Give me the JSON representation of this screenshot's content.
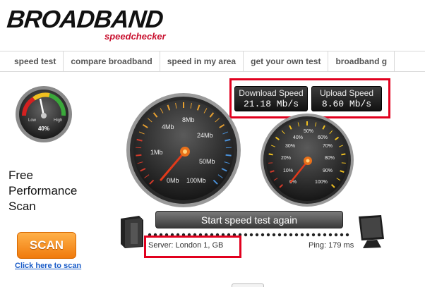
{
  "logo": {
    "word": "BROADBAND",
    "sub": "speedchecker"
  },
  "nav": [
    "speed test",
    "compare broadband",
    "speed in my area",
    "get your own test",
    "broadband g"
  ],
  "mini_gauge": {
    "low": "Low",
    "high": "High",
    "percent": "40%",
    "level": 0.4
  },
  "promo": {
    "line1": "Free",
    "line2": "Performance",
    "line3": "Scan"
  },
  "scan": {
    "button": "SCAN",
    "link": "Click here to scan"
  },
  "download": {
    "label": "Download Speed",
    "value": "21.18  Mb/s"
  },
  "upload": {
    "label": "Upload Speed",
    "value": "8.60  Mb/s"
  },
  "speed_gauge": {
    "ticks": [
      "0Mb",
      "1Mb",
      "4Mb",
      "8Mb",
      "24Mb",
      "50Mb",
      "100Mb"
    ]
  },
  "upload_gauge": {
    "ticks": [
      "0%",
      "10%",
      "20%",
      "30%",
      "40%",
      "50%",
      "60%",
      "70%",
      "80%",
      "90%",
      "100%"
    ]
  },
  "start_button": "Start speed test again",
  "server": "Server: London 1, GB",
  "ping": "Ping: 179 ms",
  "colors": {
    "highlight": "#e1001e",
    "brand_red": "#c8102e",
    "scan_orange": "#f07a0c",
    "link_blue": "#1a5cc8"
  }
}
